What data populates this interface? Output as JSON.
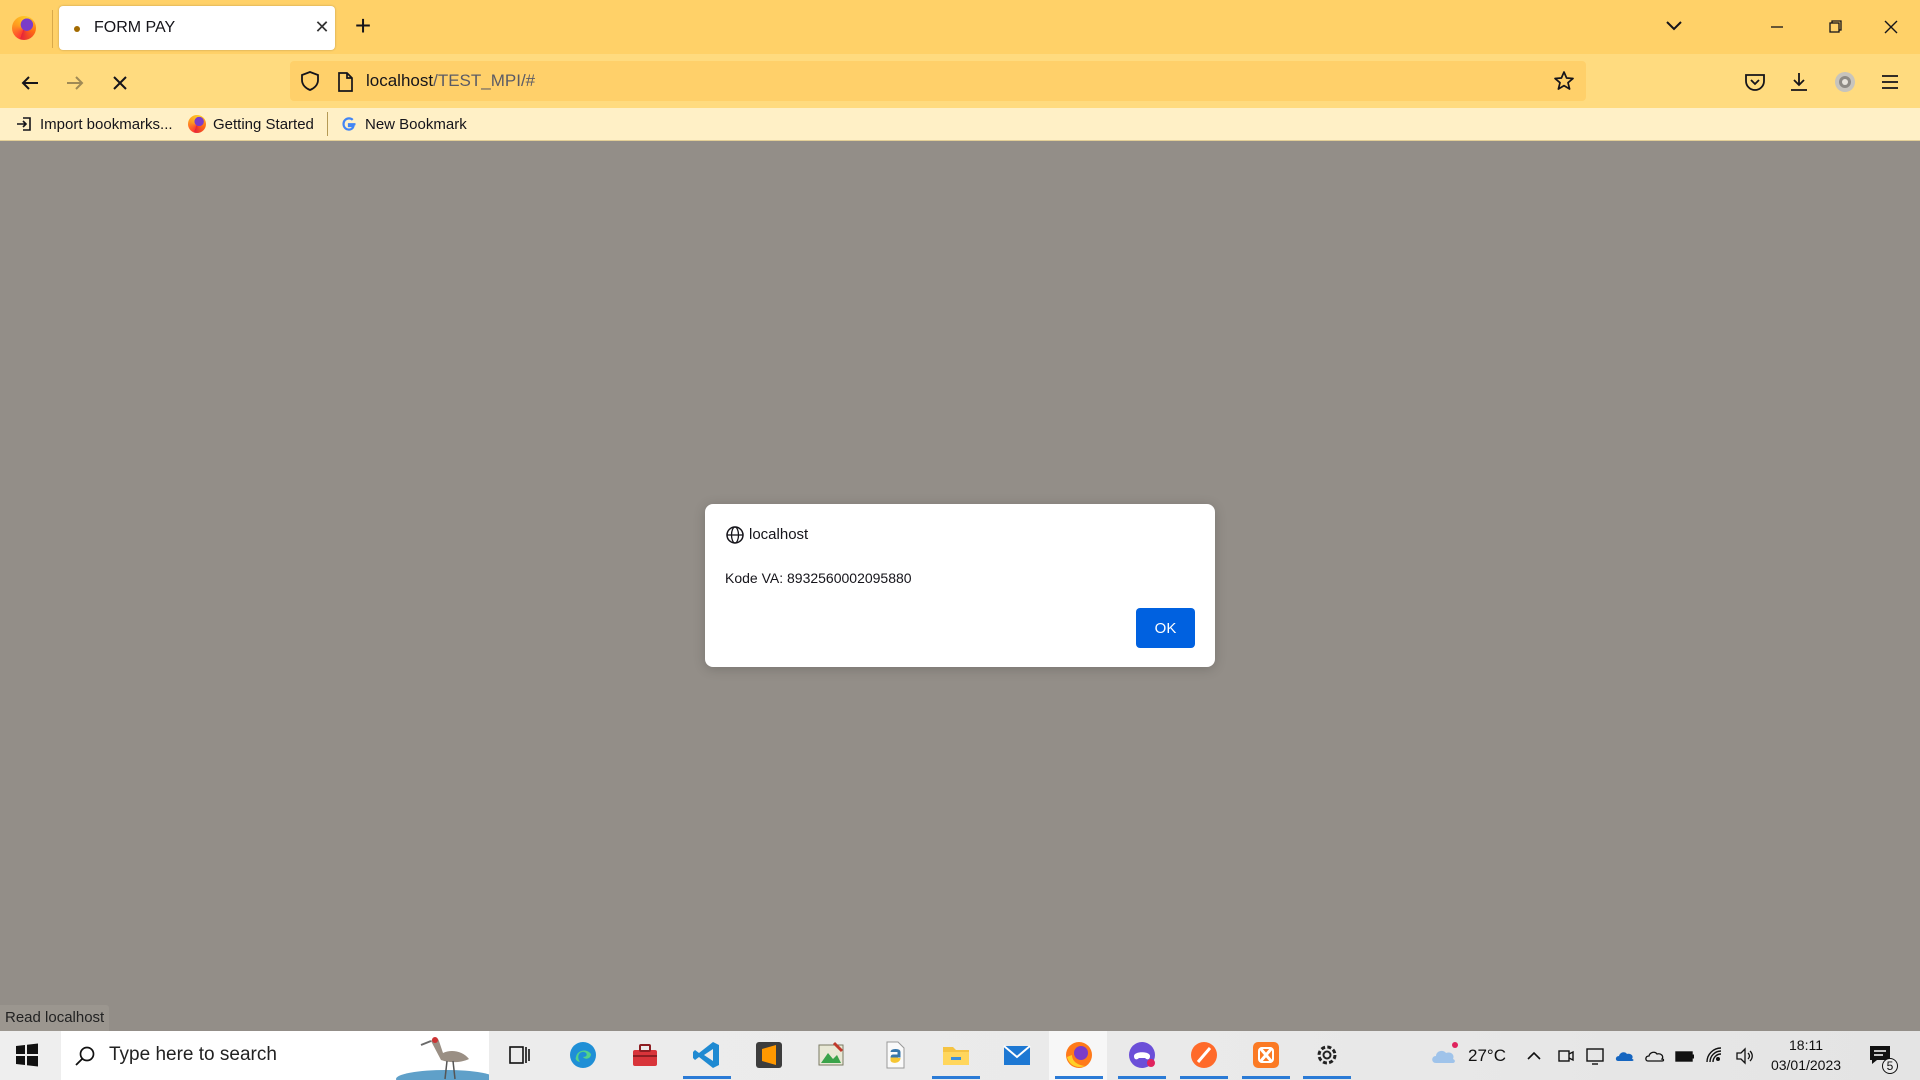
{
  "browser": {
    "tab": {
      "title": "FORM PAY",
      "close_glyph": "✕"
    },
    "new_tab_glyph": "+",
    "url": {
      "host": "localhost",
      "path": "/TEST_MPI/#"
    },
    "bookmarks": [
      {
        "label": "Import bookmarks...",
        "icon": "import-icon"
      },
      {
        "label": "Getting Started",
        "icon": "firefox-icon"
      },
      {
        "label": "New Bookmark",
        "icon": "google-icon"
      }
    ],
    "status_text": "Read localhost"
  },
  "dialog": {
    "origin": "localhost",
    "message": "Kode VA: 8932560002095880",
    "ok_label": "OK"
  },
  "taskbar": {
    "search_placeholder": "Type here to search",
    "weather": "27°C",
    "time": "18:11",
    "date": "03/01/2023",
    "notification_count": "5"
  },
  "colors": {
    "tab_strip": "#ffd168",
    "toolbar": "#ffdb7f",
    "bookmarks_bar": "#fff0c6",
    "page_overlay": "#938e88",
    "ok_button": "#0061e0"
  }
}
